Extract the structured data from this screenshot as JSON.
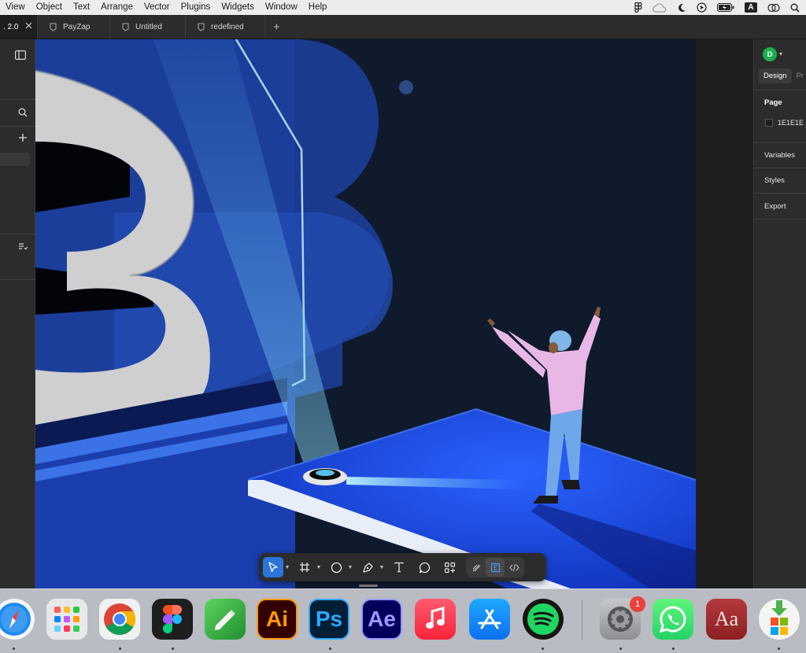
{
  "menubar": {
    "items": [
      "View",
      "Object",
      "Text",
      "Arrange",
      "Vector",
      "Plugins",
      "Widgets",
      "Window",
      "Help"
    ],
    "input_indicator": "A"
  },
  "tabs": {
    "active_label": ". 2.0",
    "items": [
      {
        "label": "PayZap"
      },
      {
        "label": "Untitled"
      },
      {
        "label": "redefined"
      }
    ],
    "add_label": "+"
  },
  "right_panel": {
    "avatar_letter": "D",
    "tab_design": "Design",
    "tab_prototype": "Pr",
    "page_label": "Page",
    "page_color": "1E1E1E",
    "variables_label": "Variables",
    "styles_label": "Styles",
    "export_label": "Export"
  },
  "toolbar": {
    "tools": [
      "move-tool",
      "frame-tool",
      "shape-tool",
      "pen-tool",
      "text-tool",
      "comment-tool",
      "actions-tool"
    ],
    "modes": [
      "draw-mode",
      "design-mode",
      "dev-mode"
    ],
    "active_tool": "move-tool"
  },
  "dock": {
    "apps": [
      {
        "name": "Safari"
      },
      {
        "name": "Launchpad"
      },
      {
        "name": "Chrome"
      },
      {
        "name": "Figma"
      },
      {
        "name": "Pencil"
      },
      {
        "name": "Illustrator",
        "label": "Ai"
      },
      {
        "name": "Photoshop",
        "label": "Ps"
      },
      {
        "name": "After Effects",
        "label": "Ae"
      },
      {
        "name": "Music"
      },
      {
        "name": "App Store"
      },
      {
        "name": "Spotify"
      },
      {
        "name": "System Settings",
        "badge": "1"
      },
      {
        "name": "WhatsApp"
      },
      {
        "name": "Dictionary",
        "label": "Aa"
      },
      {
        "name": "Installer"
      }
    ]
  },
  "colors": {
    "canvas_bg": "#1e1e1e",
    "panel_bg": "#2c2c2c",
    "accent": "#2b74d8",
    "artwork_bg": "#0f1a2d",
    "art_blue": "#1f48c9"
  }
}
